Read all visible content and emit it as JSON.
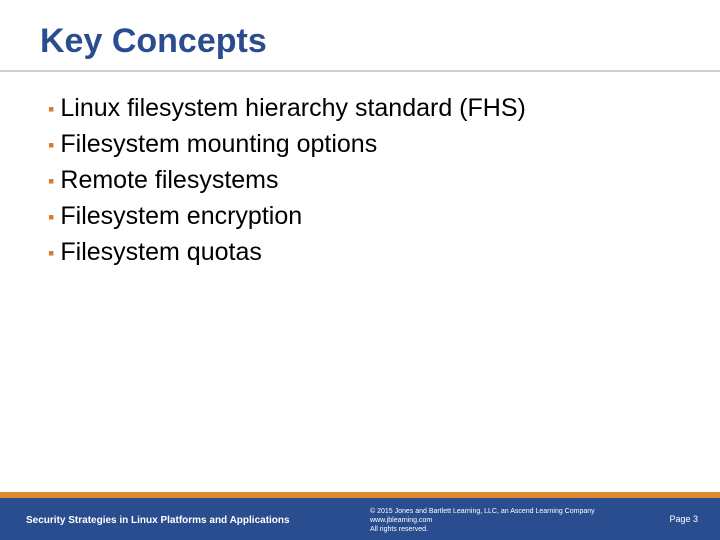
{
  "title": "Key Concepts",
  "bullets": [
    "Linux filesystem hierarchy standard (FHS)",
    "Filesystem mounting options",
    "Remote filesystems",
    "Filesystem encryption",
    "Filesystem quotas"
  ],
  "footer": {
    "left": "Security Strategies in Linux Platforms and Applications",
    "copyright_line1": "© 2015 Jones and Bartlett Learning, LLC, an Ascend Learning Company",
    "copyright_line2": "www.jblearning.com",
    "copyright_line3": "All rights reserved.",
    "page": "Page 3"
  }
}
